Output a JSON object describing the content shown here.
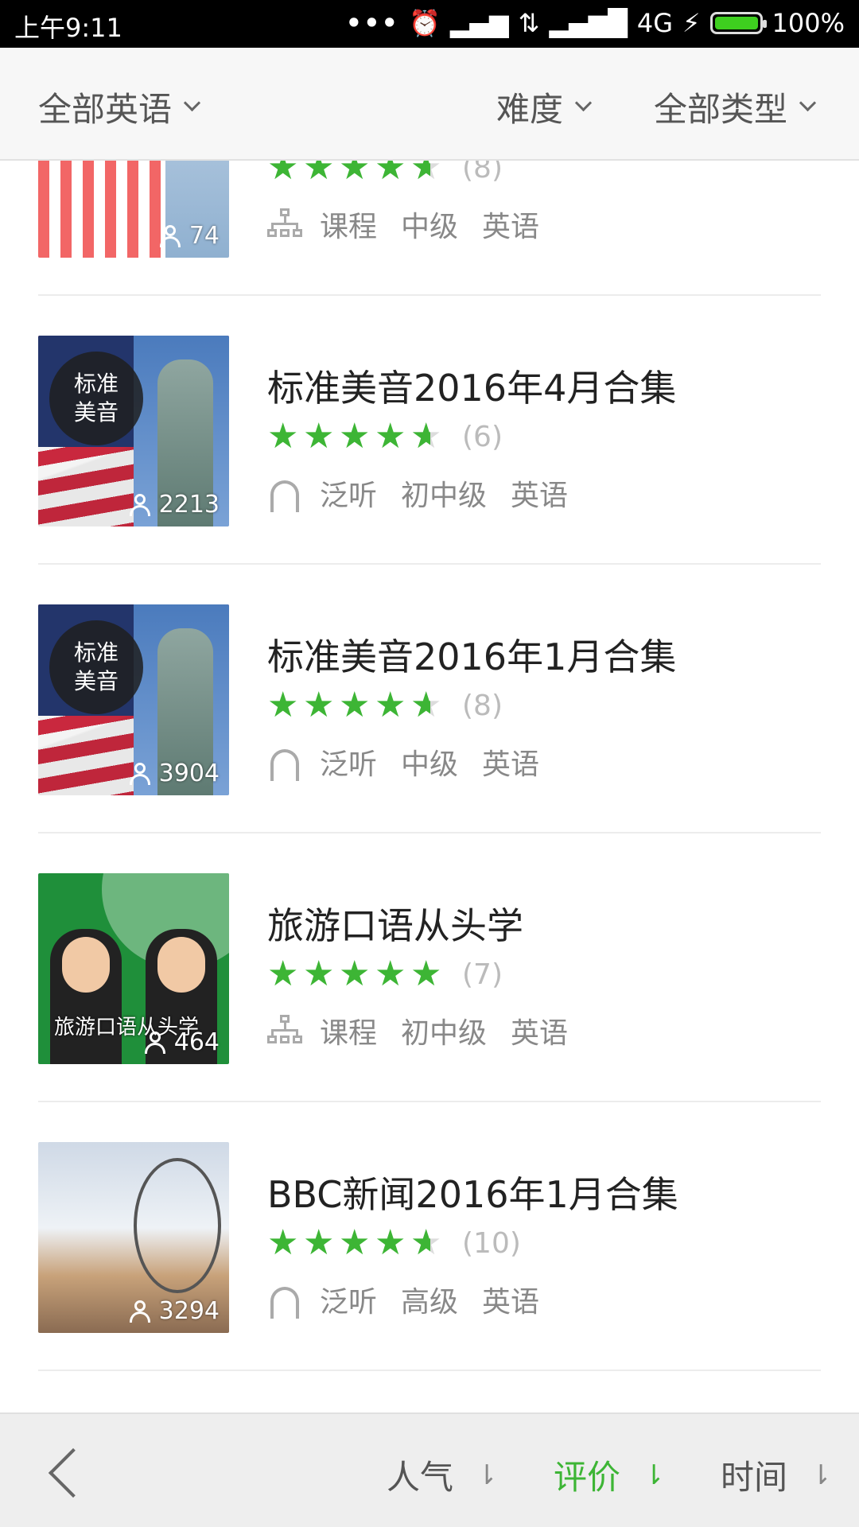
{
  "status_bar": {
    "time": "上午9:11",
    "network": "4G",
    "battery": "100%"
  },
  "filters": {
    "language": "全部英语",
    "difficulty": "难度",
    "type": "全部类型"
  },
  "items": [
    {
      "title": "",
      "rating": 4.5,
      "rating_count": "(8)",
      "type_icon": "course-tree-icon",
      "type": "课程",
      "level": "中级",
      "language": "英语",
      "listeners": "74"
    },
    {
      "title": "标准美音2016年4月合集",
      "badge_line1": "标准",
      "badge_line2": "美音",
      "rating": 4.5,
      "rating_count": "(6)",
      "type_icon": "headphones-icon",
      "type": "泛听",
      "level": "初中级",
      "language": "英语",
      "listeners": "2213"
    },
    {
      "title": "标准美音2016年1月合集",
      "badge_line1": "标准",
      "badge_line2": "美音",
      "rating": 4.5,
      "rating_count": "(8)",
      "type_icon": "headphones-icon",
      "type": "泛听",
      "level": "中级",
      "language": "英语",
      "listeners": "3904"
    },
    {
      "title": "旅游口语从头学",
      "caption": "旅游口语从头学",
      "rating": 5,
      "rating_count": "(7)",
      "type_icon": "course-tree-icon",
      "type": "课程",
      "level": "初中级",
      "language": "英语",
      "listeners": "464"
    },
    {
      "title": "BBC新闻2016年1月合集",
      "rating": 4.5,
      "rating_count": "(10)",
      "type_icon": "headphones-icon",
      "type": "泛听",
      "level": "高级",
      "language": "英语",
      "listeners": "3294"
    }
  ],
  "sort_bar": {
    "popularity": "人气",
    "rating": "评价",
    "time": "时间",
    "arrow": "⇂",
    "active": "rating"
  },
  "colors": {
    "accent": "#3db535",
    "star_empty": "#dcdcdc"
  }
}
